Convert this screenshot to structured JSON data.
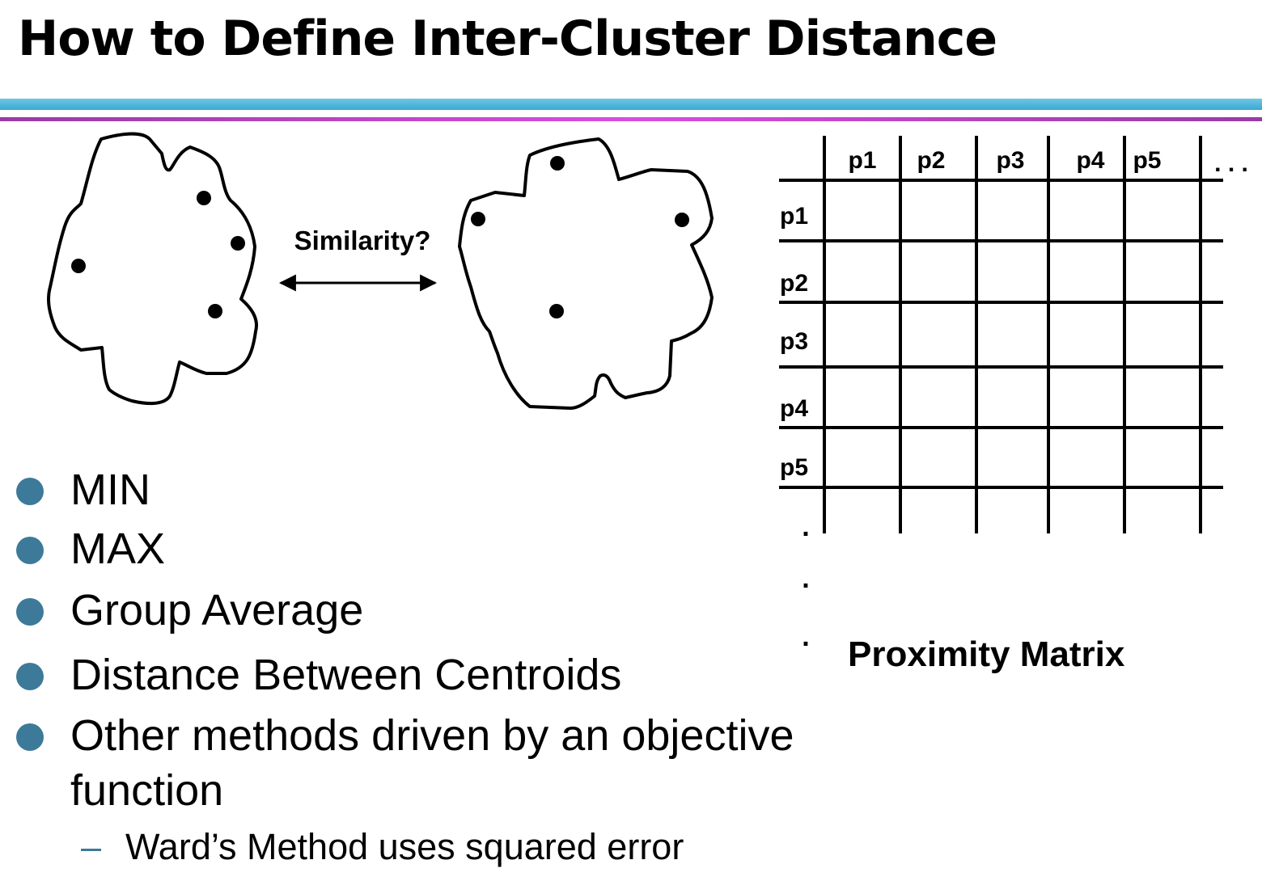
{
  "title": "How to Define Inter-Cluster Distance",
  "similarity_label": "Similarity?",
  "proximity_matrix": {
    "title": "Proximity Matrix",
    "column_headers": [
      "p1",
      "p2",
      "p3",
      "p4",
      "p5"
    ],
    "row_headers": [
      "p1",
      "p2",
      "p3",
      "p4",
      "p5"
    ],
    "column_ellipsis": ". . .",
    "row_ellipsis": [
      ".",
      ".",
      "."
    ]
  },
  "bullets": [
    {
      "text": "MIN"
    },
    {
      "text": "MAX"
    },
    {
      "text": "Group Average"
    },
    {
      "text": "Distance Between Centroids"
    },
    {
      "text": "Other methods driven by an objective function"
    }
  ],
  "sub_bullet": {
    "dash": "–",
    "text": "Ward’s Method uses squared error"
  },
  "colors": {
    "bullet": "#3d7a99",
    "rule_blue": "#4ab0d8",
    "rule_purple": "#d84de0"
  }
}
